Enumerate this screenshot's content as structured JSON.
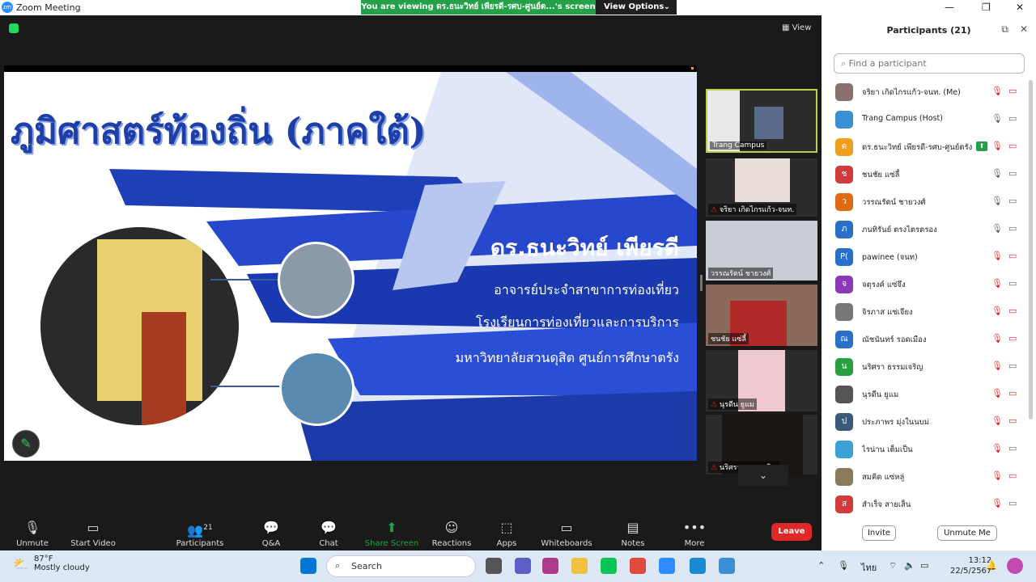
{
  "window": {
    "title": "Zoom Meeting"
  },
  "banner": {
    "text": "You are viewing ดร.ธนะวิทย์ เพียรดี-รศบ-ศูนย์ต...'s screen",
    "options": "View Options"
  },
  "stage": {
    "view_label": "View"
  },
  "slide": {
    "title": "ภูมิศาสตร์ท้องถิ่น (ภาคใต้)",
    "name": "ดร.ธนะวิทย์ เพียรดี",
    "line1": "อาจารย์ประจำสาขาการท่องเที่ยว",
    "line2": "โรงเรียนการท่องเที่ยวและการบริการ",
    "line3": "มหาวิทยาลัยสวนดุสิต ศูนย์การศึกษาตรัง"
  },
  "videos": [
    {
      "label": "Trang Campus"
    },
    {
      "label": "จริยา เกิดไกรแก้ว-จนท."
    },
    {
      "label": "วรรณรัตน์ ชายวงศ์"
    },
    {
      "label": "ชนชัย แซ่ลี้"
    },
    {
      "label": "นุรดีน ยูแม"
    },
    {
      "label": "นริศรา ธรรมเจริญ"
    }
  ],
  "toolbar": {
    "unmute": "Unmute",
    "start_video": "Start Video",
    "participants": "Participants",
    "participants_count": "21",
    "qa": "Q&A",
    "chat": "Chat",
    "share": "Share Screen",
    "reactions": "Reactions",
    "apps": "Apps",
    "whiteboards": "Whiteboards",
    "notes": "Notes",
    "more": "More",
    "leave": "Leave"
  },
  "panel": {
    "title": "Participants (21)",
    "search_placeholder": "Find a participant",
    "invite": "Invite",
    "unmute_me": "Unmute Me",
    "participants": [
      {
        "name": "จริยา เกิดไกรแก้ว-จนท. (Me)",
        "initial": "",
        "color": "#8a7070",
        "mic": "muted",
        "cam": "off"
      },
      {
        "name": "Trang Campus (Host)",
        "initial": "",
        "color": "#3a8fd6",
        "mic": "on",
        "cam": "on"
      },
      {
        "name": "ดร.ธนะวิทย์ เพียรดี-รศบ-ศูนย์ตรัง",
        "initial": "ด",
        "color": "#f0a020",
        "mic": "muted",
        "cam": "off"
      },
      {
        "name": "ชนชัย แซ่ลี้",
        "initial": "ช",
        "color": "#d03a3a",
        "mic": "on",
        "cam": "on"
      },
      {
        "name": "วรรณรัตน์ ชายวงศ์",
        "initial": "ว",
        "color": "#e06a10",
        "mic": "on",
        "cam": "on"
      },
      {
        "name": "ภนทิรันย์ ตรงไตรตรอง",
        "initial": "ภ",
        "color": "#2a6fc9",
        "mic": "on",
        "cam": "on"
      },
      {
        "name": "pawinee (จนท)",
        "initial": "P(",
        "color": "#2a6fc9",
        "mic": "muted",
        "cam": "off"
      },
      {
        "name": "จตุรงค์ แซ่จึง",
        "initial": "จ",
        "color": "#8a3ab8",
        "mic": "muted",
        "cam": "on"
      },
      {
        "name": "จิรภาส แซ่เจียง",
        "initial": "",
        "color": "#777",
        "mic": "muted",
        "cam": "off"
      },
      {
        "name": "ณัชนันทร์ รอดเมือง",
        "initial": "ณ",
        "color": "#2a6fc9",
        "mic": "muted",
        "cam": "off"
      },
      {
        "name": "นริศรา ธรรมเจริญ",
        "initial": "น",
        "color": "#28a040",
        "mic": "muted",
        "cam": "on"
      },
      {
        "name": "นุรดีน ยูแม",
        "initial": "",
        "color": "#555",
        "mic": "muted",
        "cam": "off"
      },
      {
        "name": "ประภาพร มุ่งในนบม่",
        "initial": "ป",
        "color": "#3a5a7a",
        "mic": "muted",
        "cam": "off"
      },
      {
        "name": "ไรน่าน เต็มเป็น",
        "initial": "",
        "color": "#3aa0d6",
        "mic": "muted",
        "cam": "on"
      },
      {
        "name": "สมคิด แซ่หลู่",
        "initial": "",
        "color": "#8a7a5a",
        "mic": "muted",
        "cam": "off"
      },
      {
        "name": "สำเร็จ สายเส็น",
        "initial": "ส",
        "color": "#d03a3a",
        "mic": "muted",
        "cam": "on"
      }
    ]
  },
  "taskbar": {
    "temp": "87°F",
    "weather": "Mostly cloudy",
    "search": "Search",
    "lang": "ไทย",
    "time": "13:12",
    "date": "22/5/2567"
  }
}
